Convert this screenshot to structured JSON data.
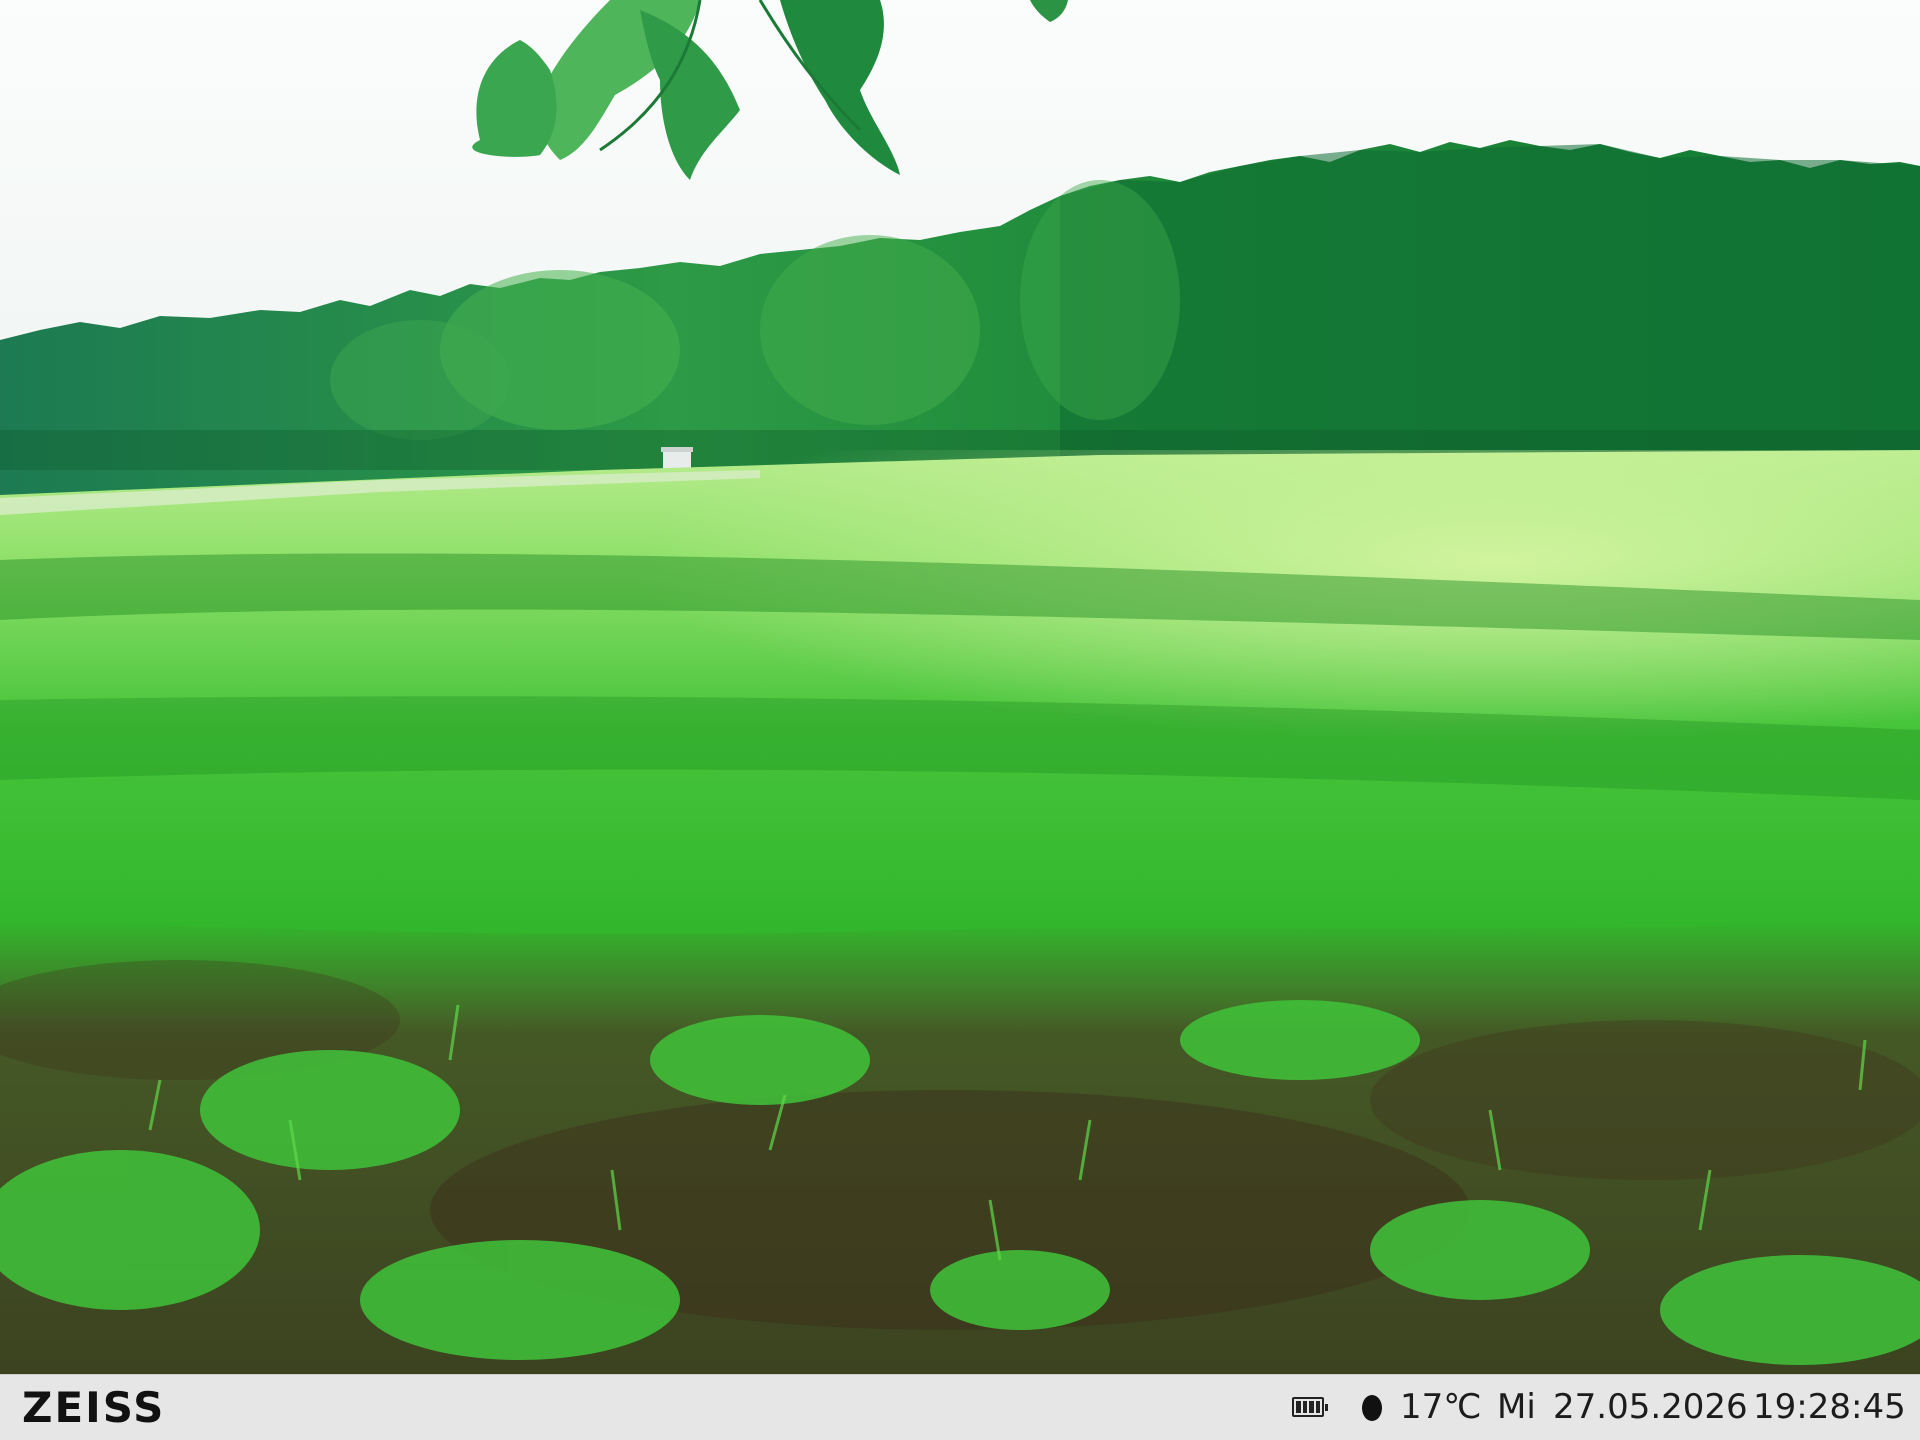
{
  "camera": {
    "brand": "ZEISS",
    "temperature": "17℃",
    "weekday": "Mi",
    "date": "27.05.2026",
    "time": "19:28:45"
  },
  "icons": {
    "battery": "battery-icon",
    "moon_phase": "moon-phase-icon"
  },
  "colors": {
    "sky": "#f7f9f8",
    "forest": "#1f8a3c",
    "meadow": "#3fbf2a",
    "soil": "#4a3a26",
    "infobar": "#e6e6e6"
  }
}
